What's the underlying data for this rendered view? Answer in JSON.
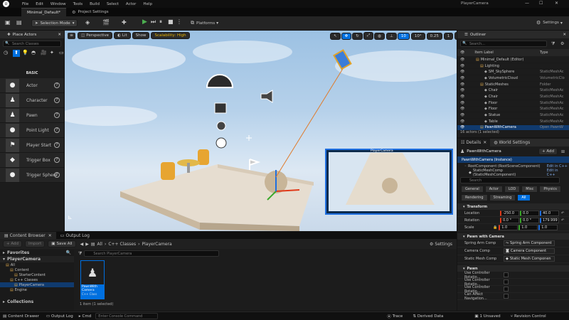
{
  "titlebar": {
    "menu": [
      "File",
      "Edit",
      "Window",
      "Tools",
      "Build",
      "Select",
      "Actor",
      "Help"
    ],
    "window_title": "PlayerCamera"
  },
  "tabs": {
    "level_tab": "Minimal_Default*",
    "project_settings": "Project Settings"
  },
  "toolbar": {
    "selection_mode": "Selection Mode",
    "platforms": "Platforms",
    "settings": "Settings"
  },
  "place_actors": {
    "title": "Place Actors",
    "search_placeholder": "Search Classes",
    "category": "BASIC",
    "items": [
      {
        "label": "Actor",
        "icon": "sphere-icon"
      },
      {
        "label": "Character",
        "icon": "pawn-icon"
      },
      {
        "label": "Pawn",
        "icon": "pawn-icon"
      },
      {
        "label": "Point Light",
        "icon": "bulb-icon"
      },
      {
        "label": "Player Start",
        "icon": "flag-icon"
      },
      {
        "label": "Trigger Box",
        "icon": "cube-icon"
      },
      {
        "label": "Trigger Sphere",
        "icon": "sphere-icon"
      }
    ]
  },
  "viewport": {
    "perspective": "Perspective",
    "lit": "Lit",
    "show": "Show",
    "scalability": "Scalability: High",
    "grid_snap": "10",
    "rot_snap": "10°",
    "scale_snap": "0.25",
    "cam_speed": "1",
    "preview_label": "PlayerCamera"
  },
  "outliner": {
    "title": "Outliner",
    "search_placeholder": "Search...",
    "col_label": "Item Label",
    "col_type": "Type",
    "rows": [
      {
        "label": "Minimal_Default (Editor)",
        "type": "",
        "indent": 0
      },
      {
        "label": "Lighting",
        "type": "",
        "indent": 1
      },
      {
        "label": "SM_SkySphere",
        "type": "StaticMeshAc",
        "indent": 2
      },
      {
        "label": "VolumetricCloud",
        "type": "VolumetricClo",
        "indent": 2
      },
      {
        "label": "StaticMeshes",
        "type": "Folder",
        "indent": 1
      },
      {
        "label": "Chair",
        "type": "StaticMeshAc",
        "indent": 2
      },
      {
        "label": "Chair",
        "type": "StaticMeshAc",
        "indent": 2
      },
      {
        "label": "Floor",
        "type": "StaticMeshAc",
        "indent": 2
      },
      {
        "label": "Floor",
        "type": "StaticMeshAc",
        "indent": 2
      },
      {
        "label": "Statue",
        "type": "StaticMeshAc",
        "indent": 2
      },
      {
        "label": "Table",
        "type": "StaticMeshAc",
        "indent": 2
      },
      {
        "label": "PawnWithCamera",
        "type": "Open PawnW",
        "indent": 1
      }
    ],
    "footer": "16 actors (1 selected)"
  },
  "details": {
    "tab_details": "Details",
    "tab_world": "World Settings",
    "actor_name": "PawnWithCamera",
    "add": "+ Add",
    "instance": "PawnWithCamera (Instance)",
    "root": "RootComponent (RootSceneComponent)",
    "root_edit": "Edit in C++",
    "static": "StaticMeshComp (StaticMeshComponent)",
    "static_edit": "Edit in C++",
    "search_placeholder": "Search",
    "cat_tabs": [
      "General",
      "Actor",
      "LOD",
      "Misc",
      "Physics",
      "Rendering",
      "Streaming",
      "All"
    ],
    "transform_title": "Transform",
    "location_label": "Location",
    "location": [
      "-250.0",
      "0.0",
      "40.0"
    ],
    "rotation_label": "Rotation",
    "rotation": [
      "0.0 °",
      "0.0 °",
      "179.999"
    ],
    "scale_label": "Scale",
    "scale": [
      "1.0",
      "1.0",
      "1.0"
    ],
    "pawn_title": "Pawn with Camera",
    "spring_arm_label": "Spring Arm Comp",
    "spring_arm_value": "Spring Arm Component",
    "camera_label": "Camera Comp",
    "camera_value": "Camera Component",
    "static_mesh_label": "Static Mesh Comp",
    "static_mesh_value": "Static Mesh Componen",
    "pawn_section": "Pawn",
    "pawn_rows": [
      "Use Controller Rotatio...",
      "Use Controller Rotatio...",
      "Use Controller Rotatio...",
      "Can Affect Navigation..."
    ]
  },
  "bottom_tabs": {
    "content_browser": "Content Browser",
    "output_log": "Output Log"
  },
  "content_browser": {
    "add": "+ Add",
    "import": "Import",
    "save_all": "Save All",
    "breadcrumb": [
      "All",
      "C++ Classes",
      "PlayerCamera"
    ],
    "settings": "Settings",
    "favorites": "Favorites",
    "project": "PlayerCamera",
    "tree": [
      {
        "label": "All",
        "indent": 0
      },
      {
        "label": "Content",
        "indent": 1
      },
      {
        "label": "StarterContent",
        "indent": 2
      },
      {
        "label": "C++ Classes",
        "indent": 1
      },
      {
        "label": "PlayerCamera",
        "indent": 2
      },
      {
        "label": "Engine",
        "indent": 1
      }
    ],
    "collections": "Collections",
    "search_placeholder": "Search PlayerCamera",
    "asset_name": "PawnWith Camera",
    "asset_type": "C++ Class",
    "footer": "1 item (1 selected)"
  },
  "statusbar": {
    "content_drawer": "Content Drawer",
    "output_log": "Output Log",
    "cmd": "Cmd",
    "console_placeholder": "Enter Console Command",
    "trace": "Trace",
    "derived_data": "Derived Data",
    "unsaved": "1 Unsaved",
    "revision": "Revision Control"
  },
  "colors": {
    "accent": "#0070e0",
    "selection": "#103a6e",
    "play": "#4caf50",
    "gizmo_x": "#e03a1a",
    "gizmo_y": "#3aa82a",
    "gizmo_z": "#1f6fe0",
    "scalability": "#e8b400"
  }
}
